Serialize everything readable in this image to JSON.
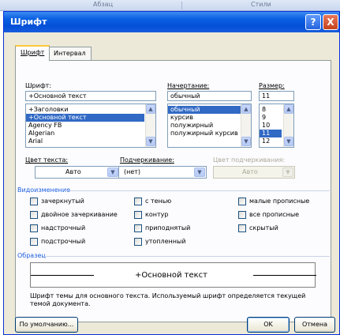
{
  "ribbon": {
    "left_label": "Абзац",
    "right_label": "Стили"
  },
  "window": {
    "title": "Шрифт",
    "help": "?",
    "close": "X"
  },
  "tabs": [
    {
      "label": "Шрифт"
    },
    {
      "label": "Интервал"
    }
  ],
  "font": {
    "label": "Шрифт:",
    "value": "+Основной текст",
    "items": [
      "+Заголовки",
      "+Основной текст",
      "Agency FB",
      "Algerian",
      "Arial"
    ],
    "selected_index": 1
  },
  "style": {
    "label": "Начертание:",
    "value": "обычный",
    "items": [
      "обычный",
      "курсив",
      "полужирный",
      "полужирный курсив"
    ],
    "selected_index": 0
  },
  "size": {
    "label": "Размер:",
    "value": "11",
    "items": [
      "8",
      "9",
      "10",
      "11",
      "12"
    ],
    "selected_index": 3
  },
  "text_color": {
    "label": "Цвет текста:",
    "value": "Авто"
  },
  "underline": {
    "label": "Подчеркивание:",
    "value": "(нет)"
  },
  "underline_color": {
    "label": "Цвет подчеркивания:",
    "value": "Авто"
  },
  "effects": {
    "title": "Видоизменение",
    "items": [
      "зачеркнутый",
      "двойное зачеркивание",
      "надстрочный",
      "подстрочный",
      "с тенью",
      "контур",
      "приподнятый",
      "утопленный",
      "малые прописные",
      "все прописные",
      "скрытый"
    ]
  },
  "preview": {
    "title": "Образец",
    "sample": "+Основной текст",
    "description": "Шрифт темы для основного текста. Используемый шрифт определяется текущей темой документа."
  },
  "buttons": {
    "default": "По умолчанию...",
    "ok": "OK",
    "cancel": "Отмена"
  },
  "colors": {
    "title_bar": "#0a5fe2",
    "selection": "#316ac5",
    "section_title": "#1d5ee0",
    "dialog_bg": "#ece9d8"
  }
}
